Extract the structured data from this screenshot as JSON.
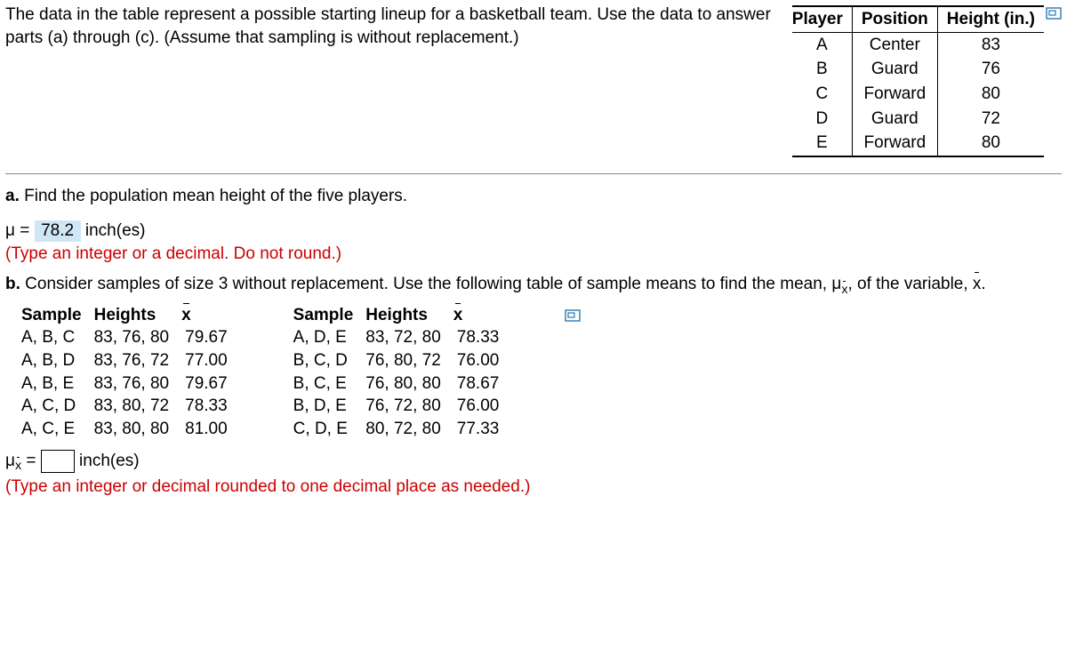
{
  "prompt": "The data in the table represent a possible starting lineup for a basketball team. Use the data to answer parts (a) through (c). (Assume that sampling is without replacement.)",
  "playerTable": {
    "headers": [
      "Player",
      "Position",
      "Height (in.)"
    ],
    "rows": [
      {
        "player": "A",
        "position": "Center",
        "height": "83"
      },
      {
        "player": "B",
        "position": "Guard",
        "height": "76"
      },
      {
        "player": "C",
        "position": "Forward",
        "height": "80"
      },
      {
        "player": "D",
        "position": "Guard",
        "height": "72"
      },
      {
        "player": "E",
        "position": "Forward",
        "height": "80"
      }
    ]
  },
  "partA": {
    "label": "a.",
    "text": "Find the population mean height of the five players.",
    "mu_equals": "μ =",
    "answer": "78.2",
    "unit": "inch(es)",
    "note": "(Type an integer or a decimal. Do not round.)"
  },
  "partB": {
    "label": "b.",
    "text1": "Consider samples of size 3 without replacement. Use the following table of sample means to find the mean, ",
    "text2": ", of the variable, ",
    "xbar": "x",
    "period": ".",
    "tableHeaders": {
      "sample": "Sample",
      "heights": "Heights",
      "xbar": "x"
    },
    "left": [
      {
        "s": "A, B, C",
        "h": "83, 76, 80",
        "x": "79.67"
      },
      {
        "s": "A, B, D",
        "h": "83, 76, 72",
        "x": "77.00"
      },
      {
        "s": "A, B, E",
        "h": "83, 76, 80",
        "x": "79.67"
      },
      {
        "s": "A, C, D",
        "h": "83, 80, 72",
        "x": "78.33"
      },
      {
        "s": "A, C, E",
        "h": "83, 80, 80",
        "x": "81.00"
      }
    ],
    "right": [
      {
        "s": "A, D, E",
        "h": "83, 72, 80",
        "x": "78.33"
      },
      {
        "s": "B, C, D",
        "h": "76, 80, 72",
        "x": "76.00"
      },
      {
        "s": "B, C, E",
        "h": "76, 80, 80",
        "x": "78.67"
      },
      {
        "s": "B, D, E",
        "h": "76, 72, 80",
        "x": "76.00"
      },
      {
        "s": "C, D, E",
        "h": "80, 72, 80",
        "x": "77.33"
      }
    ],
    "mu_equals": "=",
    "unit": "inch(es)",
    "note": "(Type an integer or decimal rounded to one decimal place as needed.)"
  },
  "chart_data": {
    "type": "table",
    "title": "Basketball lineup heights and sample means of size 3",
    "players": [
      {
        "player": "A",
        "position": "Center",
        "height_in": 83
      },
      {
        "player": "B",
        "position": "Guard",
        "height_in": 76
      },
      {
        "player": "C",
        "position": "Forward",
        "height_in": 80
      },
      {
        "player": "D",
        "position": "Guard",
        "height_in": 72
      },
      {
        "player": "E",
        "position": "Forward",
        "height_in": 80
      }
    ],
    "population_mean": 78.2,
    "samples_n3": [
      {
        "sample": "A,B,C",
        "heights": [
          83,
          76,
          80
        ],
        "xbar": 79.67
      },
      {
        "sample": "A,B,D",
        "heights": [
          83,
          76,
          72
        ],
        "xbar": 77.0
      },
      {
        "sample": "A,B,E",
        "heights": [
          83,
          76,
          80
        ],
        "xbar": 79.67
      },
      {
        "sample": "A,C,D",
        "heights": [
          83,
          80,
          72
        ],
        "xbar": 78.33
      },
      {
        "sample": "A,C,E",
        "heights": [
          83,
          80,
          80
        ],
        "xbar": 81.0
      },
      {
        "sample": "A,D,E",
        "heights": [
          83,
          72,
          80
        ],
        "xbar": 78.33
      },
      {
        "sample": "B,C,D",
        "heights": [
          76,
          80,
          72
        ],
        "xbar": 76.0
      },
      {
        "sample": "B,C,E",
        "heights": [
          76,
          80,
          80
        ],
        "xbar": 78.67
      },
      {
        "sample": "B,D,E",
        "heights": [
          76,
          72,
          80
        ],
        "xbar": 76.0
      },
      {
        "sample": "C,D,E",
        "heights": [
          80,
          72,
          80
        ],
        "xbar": 77.33
      }
    ]
  }
}
